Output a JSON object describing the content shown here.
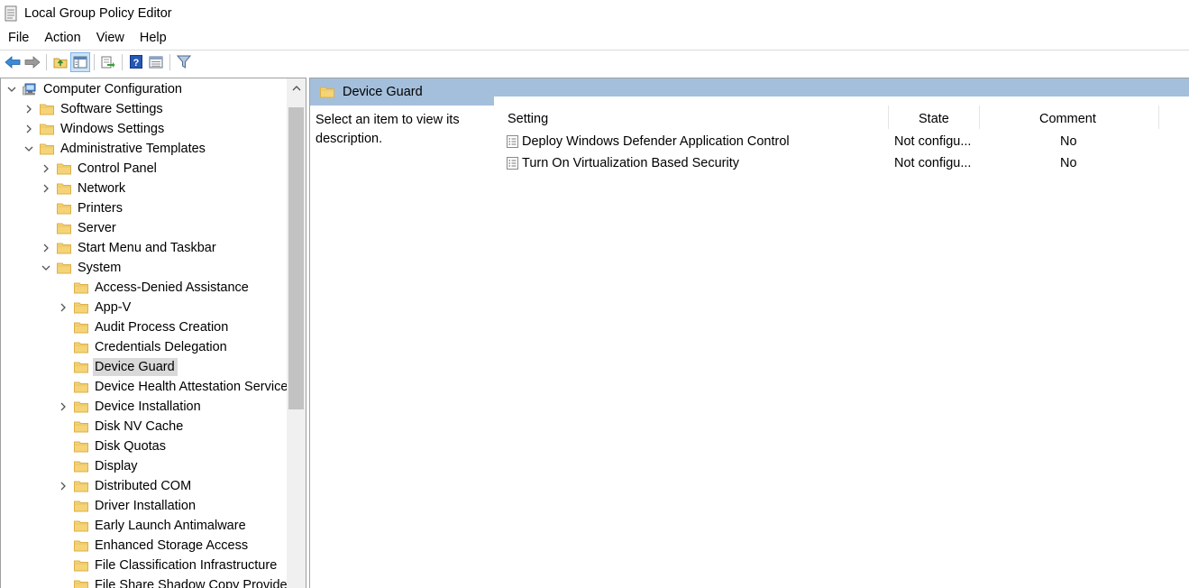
{
  "window": {
    "title": "Local Group Policy Editor"
  },
  "menu": [
    "File",
    "Action",
    "View",
    "Help"
  ],
  "toolbar": {
    "buttons": [
      "back-icon",
      "forward-icon",
      "up-folder-icon",
      "show-hide-console-tree-icon",
      "export-list-icon",
      "help-icon",
      "properties-icon",
      "filter-icon"
    ]
  },
  "tree": {
    "items": [
      {
        "label": "Computer Configuration",
        "level": 0,
        "expander": "expanded",
        "icon": "computer-icon"
      },
      {
        "label": "Software Settings",
        "level": 1,
        "expander": "collapsed",
        "icon": "folder-icon"
      },
      {
        "label": "Windows Settings",
        "level": 1,
        "expander": "collapsed",
        "icon": "folder-icon"
      },
      {
        "label": "Administrative Templates",
        "level": 1,
        "expander": "expanded",
        "icon": "folder-icon"
      },
      {
        "label": "Control Panel",
        "level": 2,
        "expander": "collapsed",
        "icon": "folder-icon"
      },
      {
        "label": "Network",
        "level": 2,
        "expander": "collapsed",
        "icon": "folder-icon"
      },
      {
        "label": "Printers",
        "level": 2,
        "expander": "none",
        "icon": "folder-icon"
      },
      {
        "label": "Server",
        "level": 2,
        "expander": "none",
        "icon": "folder-icon"
      },
      {
        "label": "Start Menu and Taskbar",
        "level": 2,
        "expander": "collapsed",
        "icon": "folder-icon"
      },
      {
        "label": "System",
        "level": 2,
        "expander": "expanded",
        "icon": "folder-icon"
      },
      {
        "label": "Access-Denied Assistance",
        "level": 3,
        "expander": "none",
        "icon": "folder-icon"
      },
      {
        "label": "App-V",
        "level": 3,
        "expander": "collapsed",
        "icon": "folder-icon"
      },
      {
        "label": "Audit Process Creation",
        "level": 3,
        "expander": "none",
        "icon": "folder-icon"
      },
      {
        "label": "Credentials Delegation",
        "level": 3,
        "expander": "none",
        "icon": "folder-icon"
      },
      {
        "label": "Device Guard",
        "level": 3,
        "expander": "none",
        "icon": "folder-icon",
        "selected": true
      },
      {
        "label": "Device Health Attestation Service",
        "level": 3,
        "expander": "none",
        "icon": "folder-icon"
      },
      {
        "label": "Device Installation",
        "level": 3,
        "expander": "collapsed",
        "icon": "folder-icon"
      },
      {
        "label": "Disk NV Cache",
        "level": 3,
        "expander": "none",
        "icon": "folder-icon"
      },
      {
        "label": "Disk Quotas",
        "level": 3,
        "expander": "none",
        "icon": "folder-icon"
      },
      {
        "label": "Display",
        "level": 3,
        "expander": "none",
        "icon": "folder-icon"
      },
      {
        "label": "Distributed COM",
        "level": 3,
        "expander": "collapsed",
        "icon": "folder-icon"
      },
      {
        "label": "Driver Installation",
        "level": 3,
        "expander": "none",
        "icon": "folder-icon"
      },
      {
        "label": "Early Launch Antimalware",
        "level": 3,
        "expander": "none",
        "icon": "folder-icon"
      },
      {
        "label": "Enhanced Storage Access",
        "level": 3,
        "expander": "none",
        "icon": "folder-icon"
      },
      {
        "label": "File Classification Infrastructure",
        "level": 3,
        "expander": "none",
        "icon": "folder-icon"
      },
      {
        "label": "File Share Shadow Copy Provider",
        "level": 3,
        "expander": "none",
        "icon": "folder-icon"
      }
    ]
  },
  "details": {
    "title": "Device Guard",
    "description": "Select an item to view its description.",
    "columns": {
      "setting": "Setting",
      "state": "State",
      "comment": "Comment"
    },
    "rows": [
      {
        "setting": "Deploy Windows Defender Application Control",
        "state": "Not configu...",
        "comment": "No"
      },
      {
        "setting": "Turn On Virtualization Based Security",
        "state": "Not configu...",
        "comment": "No"
      }
    ]
  },
  "colors": {
    "header_band": "#a4bfdb",
    "selection": "#d9d9d9",
    "folder": "#f5d477",
    "folder_dark": "#dcb04a"
  }
}
